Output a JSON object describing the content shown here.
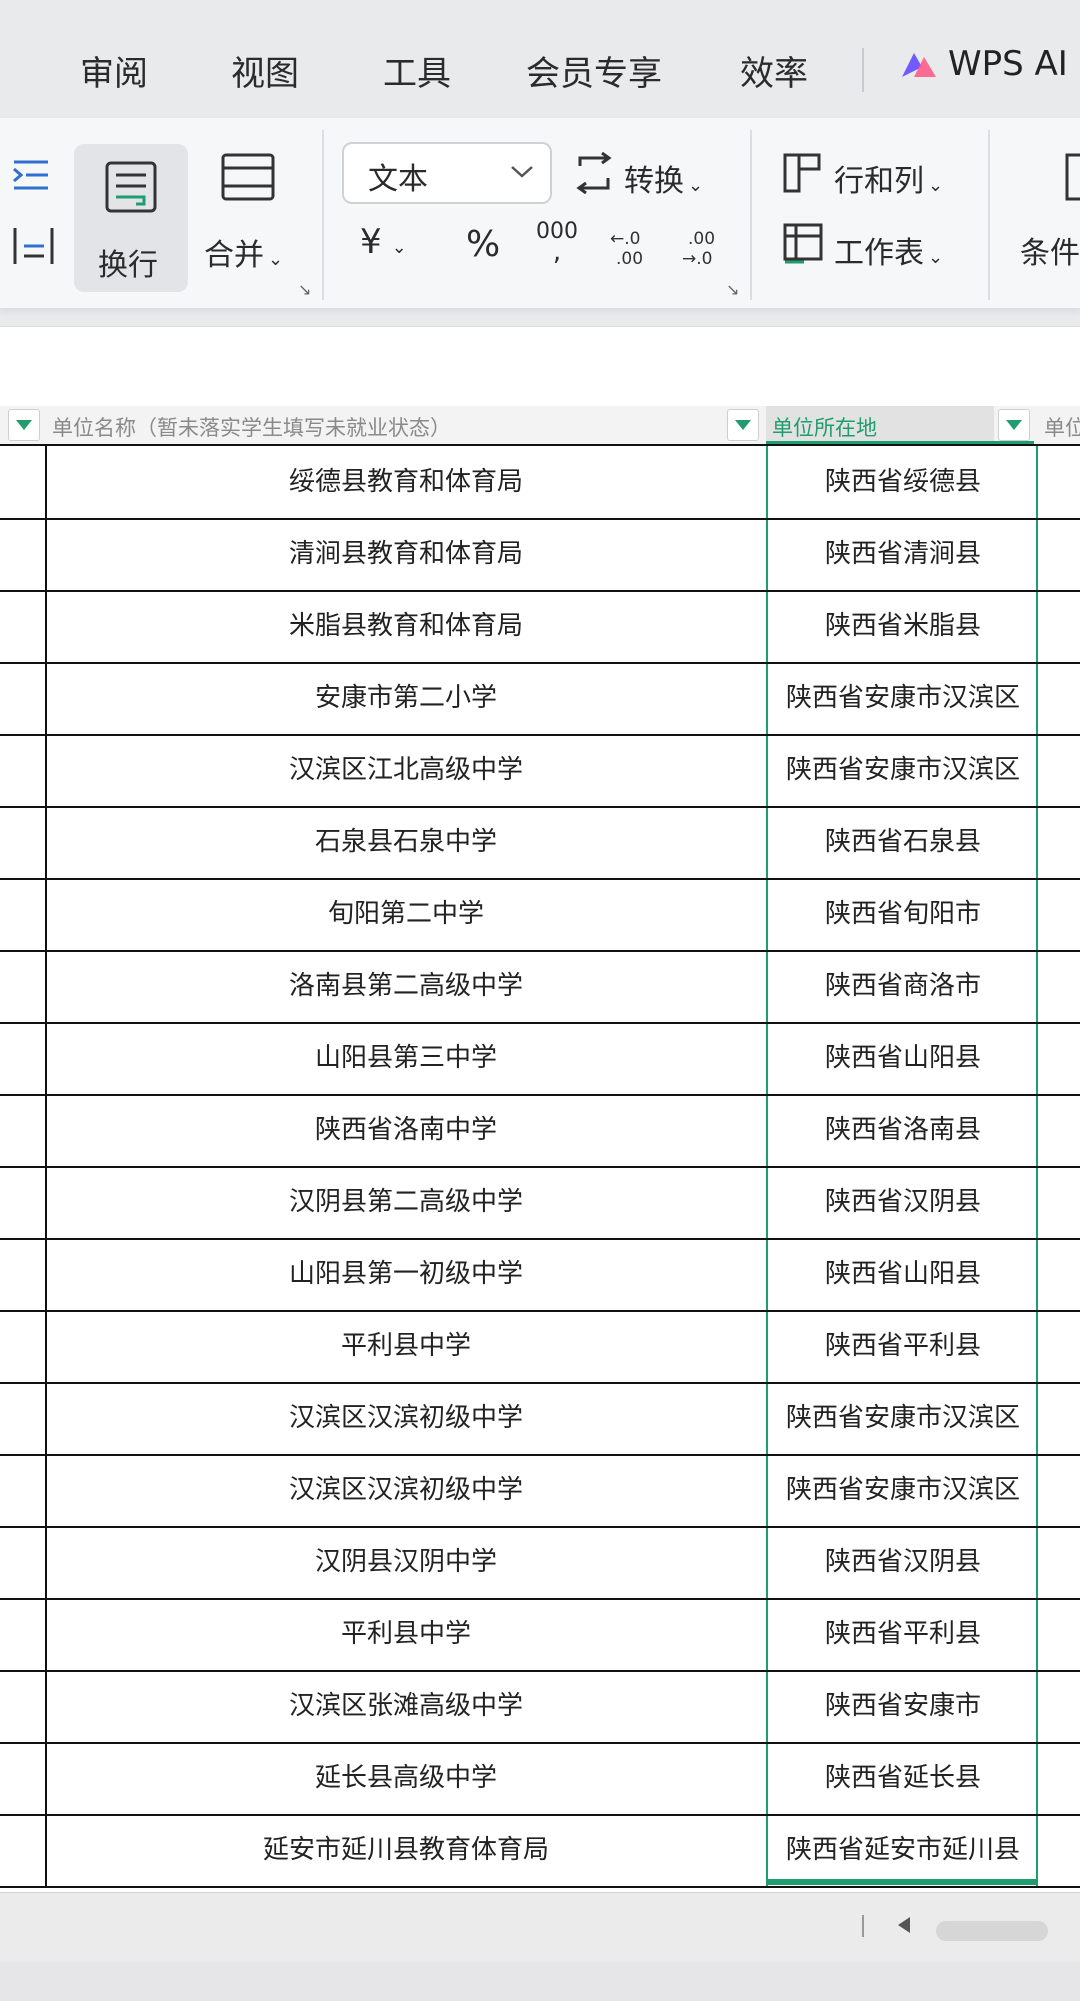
{
  "tabs": [
    "审阅",
    "视图",
    "工具",
    "会员专享",
    "效率"
  ],
  "wps_ai": {
    "label": "WPS AI",
    "icon": "wps-ai-logo-icon"
  },
  "ribbon": {
    "wrap_label": "换行",
    "merge_label": "合并",
    "format_select": "文本",
    "convert_label": "转换",
    "currency_symbol": "¥",
    "percent_symbol": "%",
    "thousands_symbol": "000",
    "rows_cols_label": "行和列",
    "worksheet_label": "工作表",
    "conditional_label": "条件"
  },
  "columns": {
    "name_header": "单位名称（暂未落实学生填写未就业状态）",
    "location_header": "单位所在地",
    "next_header": "单位"
  },
  "rows": [
    {
      "name": "绥德县教育和体育局",
      "location": "陕西省绥德县"
    },
    {
      "name": "清涧县教育和体育局",
      "location": "陕西省清涧县"
    },
    {
      "name": "米脂县教育和体育局",
      "location": "陕西省米脂县"
    },
    {
      "name": "安康市第二小学",
      "location": "陕西省安康市汉滨区"
    },
    {
      "name": "汉滨区江北高级中学",
      "location": "陕西省安康市汉滨区"
    },
    {
      "name": "石泉县石泉中学",
      "location": "陕西省石泉县"
    },
    {
      "name": "旬阳第二中学",
      "location": "陕西省旬阳市"
    },
    {
      "name": "洛南县第二高级中学",
      "location": "陕西省商洛市"
    },
    {
      "name": "山阳县第三中学",
      "location": "陕西省山阳县"
    },
    {
      "name": "陕西省洛南中学",
      "location": "陕西省洛南县"
    },
    {
      "name": "汉阴县第二高级中学",
      "location": "陕西省汉阴县"
    },
    {
      "name": "山阳县第一初级中学",
      "location": "陕西省山阳县"
    },
    {
      "name": "平利县中学",
      "location": "陕西省平利县"
    },
    {
      "name": "汉滨区汉滨初级中学",
      "location": "陕西省安康市汉滨区"
    },
    {
      "name": "汉滨区汉滨初级中学",
      "location": "陕西省安康市汉滨区"
    },
    {
      "name": "汉阴县汉阴中学",
      "location": "陕西省汉阴县"
    },
    {
      "name": "平利县中学",
      "location": "陕西省平利县"
    },
    {
      "name": "汉滨区张滩高级中学",
      "location": "陕西省安康市"
    },
    {
      "name": "延长县高级中学",
      "location": "陕西省延长县"
    },
    {
      "name": "延安市延川县教育体育局",
      "location": "陕西省延安市延川县"
    }
  ],
  "colors": {
    "accent": "#1f9d6e",
    "grid": "#111111"
  }
}
